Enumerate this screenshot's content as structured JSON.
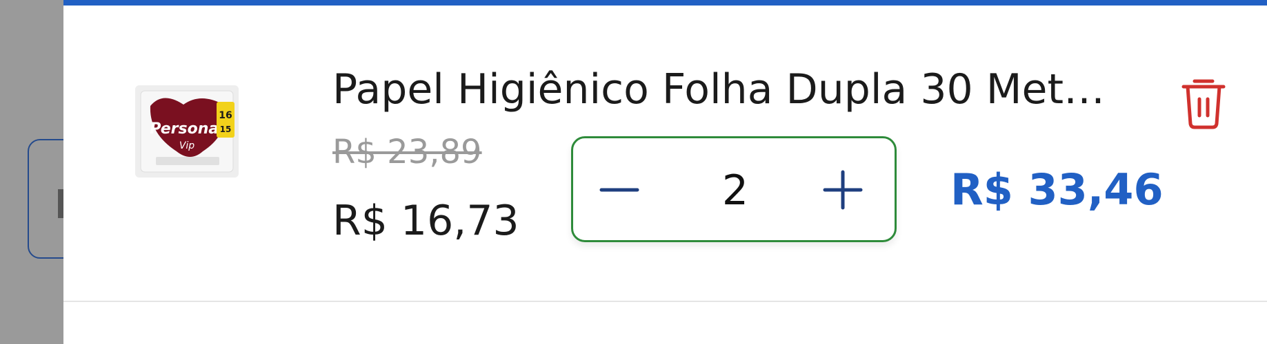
{
  "product": {
    "name": "Papel Higiênico Folha Dupla 30 Met…",
    "image_brand": "Personal Vip",
    "original_price": "R$ 23,89",
    "price": "R$ 16,73",
    "total_price": "R$ 33,46"
  },
  "quantity_stepper": {
    "value": "2"
  },
  "icons": {
    "decrement": "minus-icon",
    "increment": "plus-icon",
    "remove": "trash-icon"
  },
  "colors": {
    "accent_blue": "#2160c4",
    "stepper_border": "#2e8b3a",
    "delete_red": "#d0312d",
    "strikethrough_gray": "#9a9a9a"
  }
}
